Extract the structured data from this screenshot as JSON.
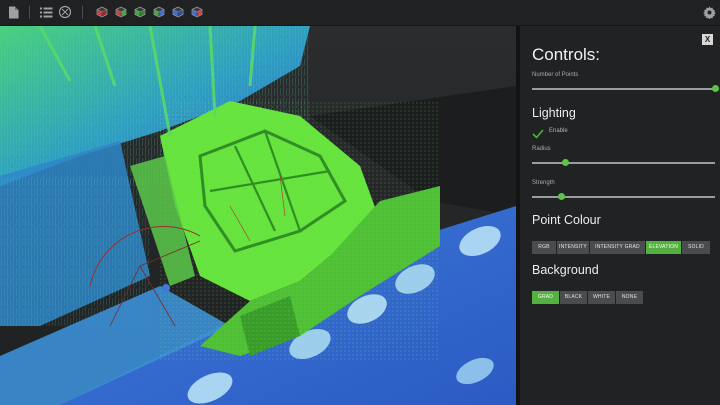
{
  "toolbar": {
    "icons": [
      "file-icon",
      "list-icon",
      "zoom-extents-icon",
      "cube-red-icon",
      "cube-red-green-icon",
      "cube-green-icon",
      "cube-green-blue-icon",
      "cube-blue-icon",
      "cube-blue-red-icon",
      "gear-icon"
    ],
    "cube_colors": [
      [
        "#d83c3c",
        "#a02828"
      ],
      [
        "#d83c3c",
        "#3fae3a"
      ],
      [
        "#3fae3a",
        "#2e8a2a"
      ],
      [
        "#3fae3a",
        "#3f6fd8"
      ],
      [
        "#3f6fd8",
        "#2b4fa8"
      ],
      [
        "#3f6fd8",
        "#d83c3c"
      ]
    ]
  },
  "panel": {
    "title": "Controls:",
    "close_label": "X",
    "points_label": "Number of Points",
    "points_value": 1.0,
    "lighting_title": "Lighting",
    "enable_label": "Enable",
    "enable_checked": true,
    "radius_label": "Radius",
    "radius_value": 0.18,
    "strength_label": "Strength",
    "strength_value": 0.16,
    "colour_title": "Point Colour",
    "colour_options": [
      "RGB",
      "INTENSITY",
      "INTENSITY GRAD",
      "ELEVATION",
      "SOLID"
    ],
    "colour_selected": "ELEVATION",
    "background_title": "Background",
    "background_options": [
      "GRAD",
      "BLACK",
      "WHITE",
      "NONE"
    ],
    "background_selected": "GRAD"
  },
  "colors": {
    "accent": "#52b13f",
    "panel_bg": "#202223",
    "elevation_high": "#5fe33a",
    "elevation_low": "#2f6fd6"
  }
}
